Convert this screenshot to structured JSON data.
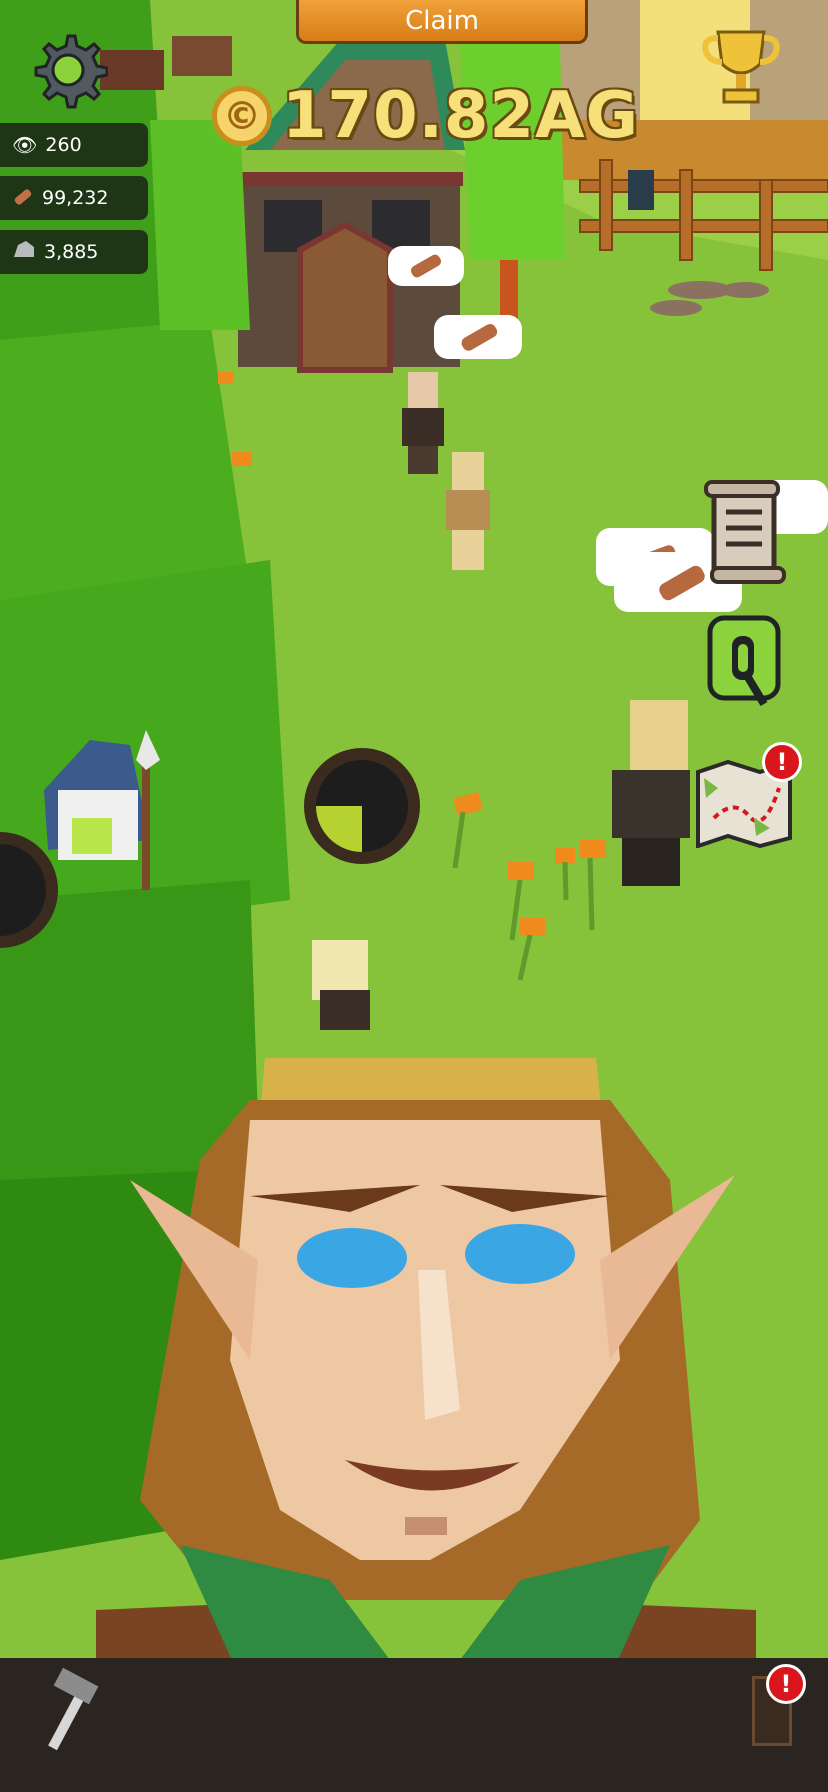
{
  "header": {
    "claim_label": "Claim",
    "currency_symbol": "©",
    "currency_amount": "170.82AG"
  },
  "stats": [
    {
      "icon": "eye-icon",
      "value": "260"
    },
    {
      "icon": "wood-log-icon",
      "value": "99,232"
    },
    {
      "icon": "stone-icon",
      "value": "3,885"
    }
  ],
  "quest_button": {
    "label": "Q"
  },
  "map_badge": "!",
  "bottom_badge": "!",
  "timer_progress": 0.25,
  "colors": {
    "accent": "#e8922a",
    "grass": "#86c23a",
    "tree": "#4cae1f",
    "badge": "#d8161b"
  }
}
